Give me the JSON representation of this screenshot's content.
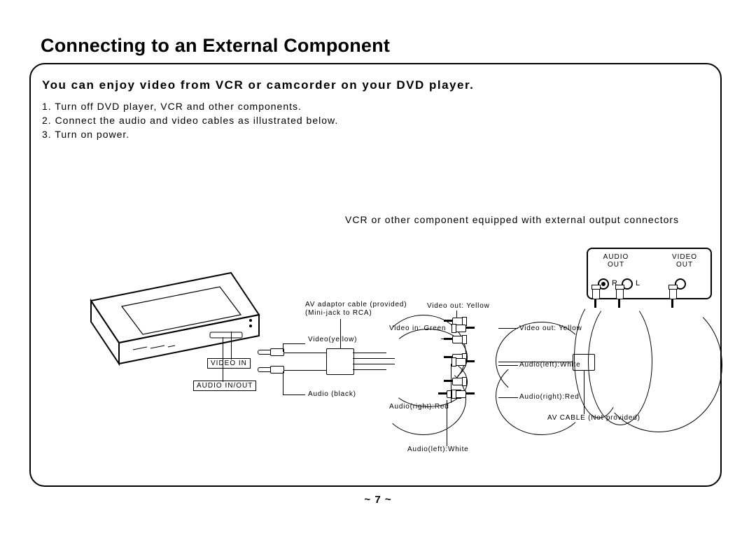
{
  "title": "Connecting to an External Component",
  "intro": "You can enjoy video from VCR or camcorder on your DVD player.",
  "steps": {
    "s1": "1. Turn off DVD player, VCR and other components.",
    "s2": "2. Connect the audio and video cables as illustrated below.",
    "s3": "3. Turn on power."
  },
  "caption_vcr": "VCR or other component equipped with external output connectors",
  "component": {
    "audio_label": "AUDIO\nOUT",
    "video_label": "VIDEO\nOUT",
    "r": "R",
    "l": "L"
  },
  "labels": {
    "av_adaptor": "AV adaptor cable (provided)\n(Mini-jack to RCA)",
    "video_yellow": "Video(yellow)",
    "audio_black": "Audio (black)",
    "video_in": "VIDEO IN",
    "audio_inout": "AUDIO IN/OUT",
    "video_out_yellow_a": "Video out: Yellow",
    "video_in_green": "Video in: Green",
    "audio_right_red_a": "Audio(right):Red",
    "audio_left_white_a": "Audio(left):White",
    "video_out_yellow_b": "Video out: Yellow",
    "audio_left_white_b": "Audio(left):White",
    "audio_right_red_b": "Audio(right):Red",
    "av_cable_not_provided": "AV CABLE (Not provided)"
  },
  "page_number": "~ 7 ~"
}
